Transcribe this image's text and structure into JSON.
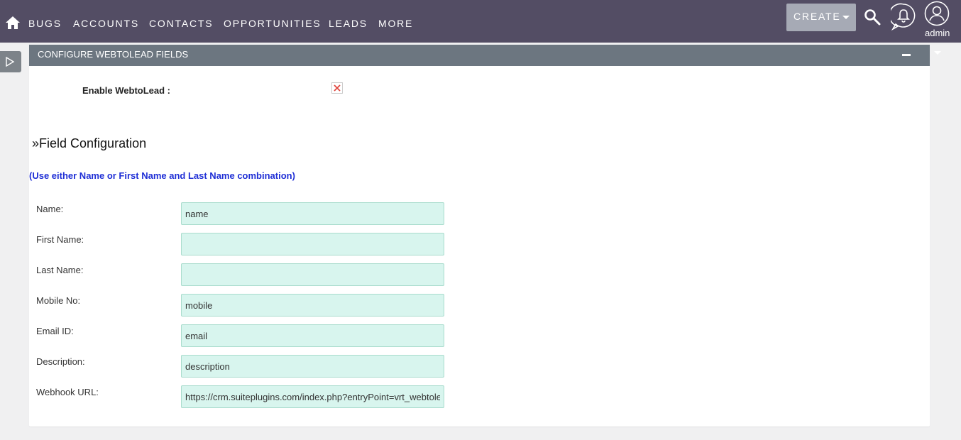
{
  "nav": {
    "items": [
      "BUGS",
      "ACCOUNTS",
      "CONTACTS",
      "OPPORTUNITIES",
      "LEADS",
      "MORE"
    ],
    "create_label": "CREATE",
    "user_label": "admin",
    "icons": [
      "home-icon",
      "search-icon",
      "bell-icon",
      "user-icon"
    ]
  },
  "panel": {
    "title": "CONFIGURE WEBTOLEAD FIELDS",
    "enable_label": "Enable WebtoLead :",
    "enable_checked": false,
    "section_heading": "»Field Configuration",
    "hint": "(Use either Name or First Name and Last Name combination)",
    "fields": [
      {
        "label": "Name:",
        "value": "name"
      },
      {
        "label": "First Name:",
        "value": ""
      },
      {
        "label": "Last Name:",
        "value": ""
      },
      {
        "label": "Mobile No:",
        "value": "mobile"
      },
      {
        "label": "Email ID:",
        "value": "email"
      },
      {
        "label": "Description:",
        "value": "description"
      },
      {
        "label": "Webhook URL:",
        "value": "https://crm.suiteplugins.com/index.php?entryPoint=vrt_webtolead"
      }
    ]
  },
  "colors": {
    "topbar": "#534d64",
    "panel_header": "#6c7680",
    "input_bg": "#d8f5ee",
    "hint": "#1f2fd6"
  }
}
